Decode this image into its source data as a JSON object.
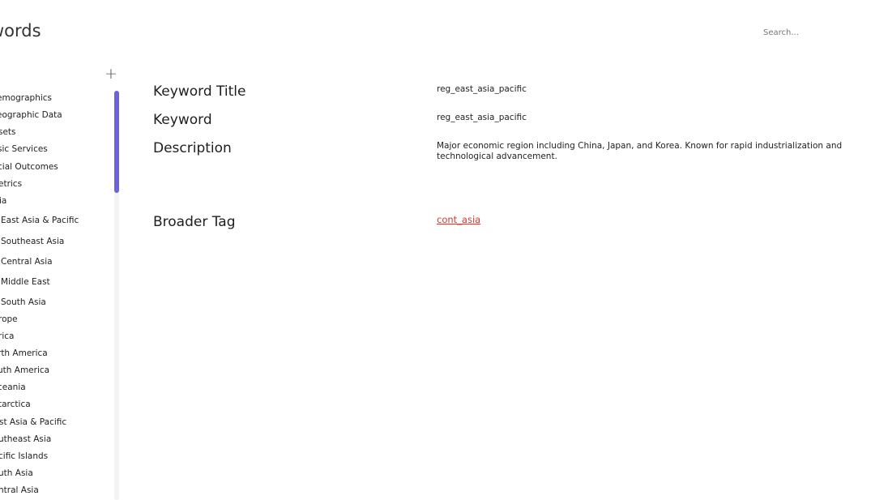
{
  "header": {
    "title": "words",
    "search_placeholder": "Search..."
  },
  "sidebar": {
    "add_label": "+",
    "items": [
      {
        "label": "emographics"
      },
      {
        "label": "eographic Data"
      },
      {
        "label": "sets"
      },
      {
        "label": "sic Services"
      },
      {
        "label": "cial Outcomes"
      },
      {
        "label": "etrics"
      },
      {
        "label": "ia"
      },
      {
        "label": "East Asia & Pacific"
      },
      {
        "label": "Southeast Asia"
      },
      {
        "label": "Central Asia"
      },
      {
        "label": "Middle East"
      },
      {
        "label": "South Asia"
      },
      {
        "label": "rope"
      },
      {
        "label": "rica"
      },
      {
        "label": "rth America"
      },
      {
        "label": "uth America"
      },
      {
        "label": "ceania"
      },
      {
        "label": "tarctica"
      },
      {
        "label": "st Asia & Pacific"
      },
      {
        "label": "utheast Asia"
      },
      {
        "label": "cific Islands"
      },
      {
        "label": "uth Asia"
      },
      {
        "label": "ntral Asia"
      }
    ]
  },
  "detail": {
    "keyword_title_label": "Keyword Title",
    "keyword_title_value": "reg_east_asia_pacific",
    "keyword_label": "Keyword",
    "keyword_value": "reg_east_asia_pacific",
    "description_label": "Description",
    "description_value": "Major economic region including China, Japan, and Korea. Known for rapid industrialization and technological advancement.",
    "broader_tag_label": "Broader Tag",
    "broader_tag_value": "cont_asia"
  },
  "colors": {
    "accent": "#6b63d6",
    "link": "#d9362b"
  }
}
